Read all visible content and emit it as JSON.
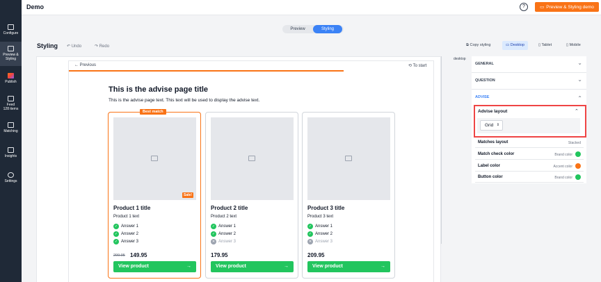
{
  "app": {
    "title": "Demo",
    "help_icon": "question-circle-icon",
    "demo_button": "Preview & Styling demo"
  },
  "sidebar": {
    "items": [
      {
        "label": "Configure",
        "icon": "configure-icon"
      },
      {
        "label": "Preview & Styling",
        "icon": "monitor-icon",
        "active": true
      },
      {
        "label": "Publish",
        "icon": "publish-icon"
      },
      {
        "label": "Feed",
        "sublabel": "128 items",
        "icon": "database-icon"
      },
      {
        "label": "Matching",
        "icon": "filter-icon"
      },
      {
        "label": "Insights",
        "icon": "chart-icon"
      },
      {
        "label": "Settings",
        "icon": "gear-icon"
      }
    ]
  },
  "mode_toggle": {
    "preview": "Preview",
    "styling": "Styling",
    "active": "Styling"
  },
  "toolbar": {
    "title": "Styling",
    "undo": "Undo",
    "redo": "Redo",
    "copy_styling": "Copy styling",
    "devices": [
      "Desktop",
      "Tablet",
      "Mobile"
    ],
    "active_device": "Desktop"
  },
  "viewport_label": "desktop",
  "preview": {
    "previous": "Previous",
    "to_start": "To start",
    "title": "This is the advise page title",
    "text": "This is the advise page text. This text will be used to display the advise text.",
    "best_match": "Best match",
    "sale": "Sale!",
    "view_button": "View product",
    "arrow": "→",
    "products": [
      {
        "title": "Product 1 title",
        "text": "Product 1 text",
        "answers": [
          {
            "label": "Answer 1",
            "ok": true
          },
          {
            "label": "Answer 2",
            "ok": true
          },
          {
            "label": "Answer 3",
            "ok": true
          }
        ],
        "old_price": "209.95",
        "price": "149.95"
      },
      {
        "title": "Product 2 title",
        "text": "Product 2 text",
        "answers": [
          {
            "label": "Answer 1",
            "ok": true
          },
          {
            "label": "Answer 2",
            "ok": false
          },
          {
            "label": "Answer 3",
            "ok": false
          }
        ],
        "price": "179.95"
      },
      {
        "title": "Product 3 title",
        "text": "Product 3 text",
        "answers": [
          {
            "label": "Answer 1",
            "ok": true
          },
          {
            "label": "Answer 2",
            "ok": true
          },
          {
            "label": "Answer 3",
            "ok": false
          }
        ],
        "price": "209.95"
      }
    ]
  },
  "panel": {
    "sections": [
      "GENERAL",
      "QUESTION",
      "ADVISE"
    ],
    "advise_layout": {
      "label": "Advise layout",
      "value": "Grid"
    },
    "rows": [
      {
        "label": "Matches layout",
        "value": "Stacked"
      },
      {
        "label": "Match check color",
        "value": "Brand color",
        "color": "#22c55e"
      },
      {
        "label": "Label color",
        "value": "Accent color",
        "color": "#f97316"
      },
      {
        "label": "Button color",
        "value": "Brand color",
        "color": "#22c55e"
      }
    ]
  },
  "colors": {
    "accent": "#f97316",
    "brand": "#22c55e",
    "primary": "#3b82f6",
    "highlight": "#ef4444"
  }
}
